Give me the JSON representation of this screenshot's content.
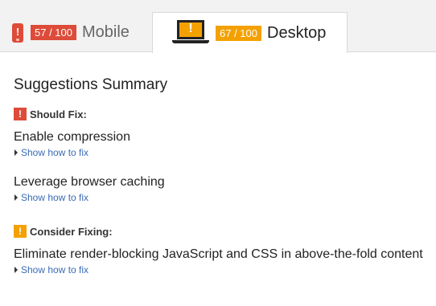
{
  "tabs": {
    "mobile": {
      "icon": "phone-warning-icon",
      "score": "57 / 100",
      "score_color": "#dd4b39",
      "label": "Mobile"
    },
    "desktop": {
      "icon": "laptop-warning-icon",
      "score": "67 / 100",
      "score_color": "#f4a100",
      "label": "Desktop",
      "selected": true
    }
  },
  "summary": {
    "title": "Suggestions Summary",
    "groups": [
      {
        "icon": "red-warning-icon",
        "color": "#dd4b39",
        "heading": "Should Fix:",
        "rules": [
          {
            "title": "Enable compression",
            "toggle": "Show how to fix"
          },
          {
            "title": "Leverage browser caching",
            "toggle": "Show how to fix"
          }
        ]
      },
      {
        "icon": "orange-warning-icon",
        "color": "#f4a100",
        "heading": "Consider Fixing:",
        "rules": [
          {
            "title": "Eliminate render-blocking JavaScript and CSS in above-the-fold content",
            "toggle": "Show how to fix"
          }
        ]
      }
    ]
  },
  "glyphs": {
    "exclamation": "!"
  }
}
